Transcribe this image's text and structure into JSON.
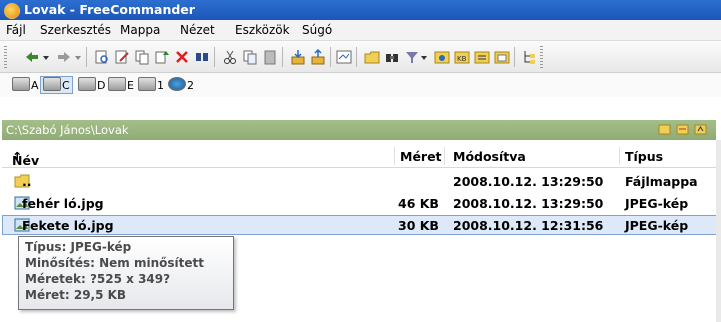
{
  "window": {
    "title": "Lovak - FreeCommander"
  },
  "menu": [
    {
      "label": "Fájl"
    },
    {
      "label": "Szerkesztés"
    },
    {
      "label": "Mappa"
    },
    {
      "label": "Nézet"
    },
    {
      "label": "Eszközök"
    },
    {
      "label": "Súgó"
    }
  ],
  "toolbar": {
    "icons": [
      "back-arrow-icon",
      "back-dropdown-icon",
      "forward-arrow-icon",
      "forward-dropdown-icon",
      "view-icon",
      "edit-icon",
      "copy-icon",
      "move-icon",
      "delete-icon",
      "find-icon",
      "cut-icon",
      "paste-icon",
      "clipboard-icon",
      "pack-icon",
      "unpack-icon",
      "compare-icon",
      "new-folder-icon",
      "search-icon",
      "filter-icon",
      "dropdown-icon",
      "folder-size-icon",
      "kb-icon",
      "properties-icon",
      "print-icon",
      "tree-icon"
    ]
  },
  "drives": [
    {
      "letter": "A",
      "selected": false
    },
    {
      "letter": "C",
      "selected": true
    },
    {
      "letter": "D",
      "selected": false
    },
    {
      "letter": "E",
      "selected": false
    },
    {
      "letter": "1",
      "selected": false
    },
    {
      "letter": "2",
      "selected": false
    }
  ],
  "path": "C:\\Szabó János\\Lovak",
  "columns": {
    "name": "Név",
    "sort_indicator": "↑",
    "size": "Méret",
    "modified": "Módosítva",
    "type": "Típus"
  },
  "rows": [
    {
      "name": "..",
      "size": "",
      "modified": "2008.10.12. 13:29:50",
      "type": "Fájlmappa",
      "icon": "folder-icon"
    },
    {
      "name": "fehér ló.jpg",
      "size": "46 KB",
      "modified": "2008.10.12. 13:29:50",
      "type": "JPEG-kép",
      "icon": "image-file-icon"
    },
    {
      "name": "Fekete ló.jpg",
      "size": "30 KB",
      "modified": "2008.10.12. 12:31:56",
      "type": "JPEG-kép",
      "icon": "image-file-icon",
      "selected": true
    }
  ],
  "tooltip": {
    "line1": "Típus: JPEG-kép",
    "line2": "Minősítés: Nem minősített",
    "line3": "Méretek: ?525 x 349?",
    "line4": "Méret: 29,5 KB"
  }
}
